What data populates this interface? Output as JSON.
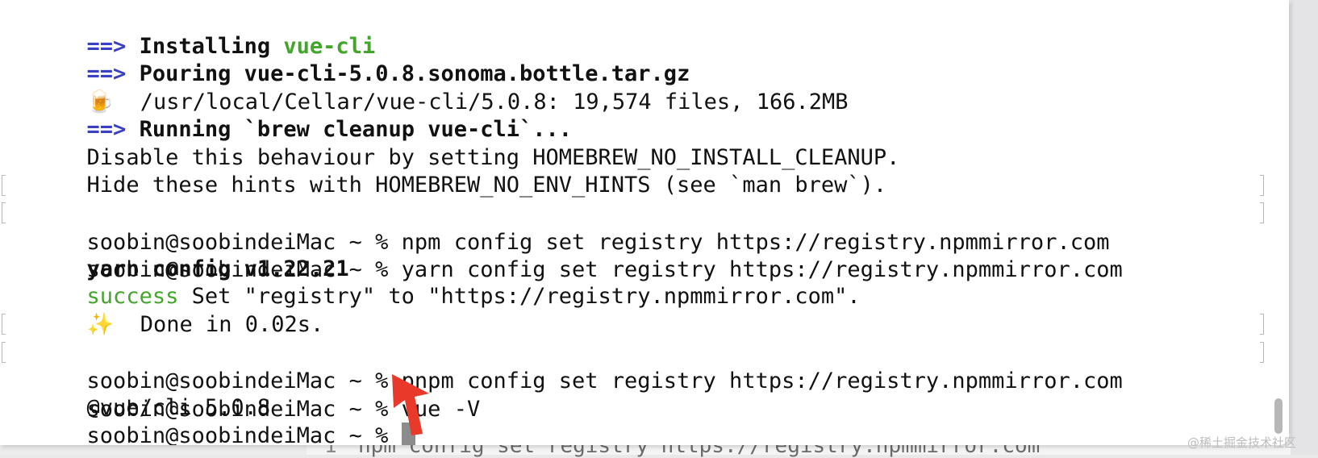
{
  "terminal": {
    "lines": [
      {
        "prefix": "==>",
        "text": "Installing ",
        "highlight": "vue-cli"
      },
      {
        "prefix": "==>",
        "text": "Pouring vue-cli-5.0.8.sonoma.bottle.tar.gz"
      },
      {
        "icon": "🍺",
        "text": "/usr/local/Cellar/vue-cli/5.0.8: 19,574 files, 166.2MB"
      },
      {
        "prefix": "==>",
        "text": "Running `brew cleanup vue-cli`..."
      },
      {
        "text": "Disable this behaviour by setting HOMEBREW_NO_INSTALL_CLEANUP."
      },
      {
        "text": "Hide these hints with HOMEBREW_NO_ENV_HINTS (see `man brew`)."
      },
      {
        "text": "soobin@soobindeiMac ~ % npm config set registry https://registry.npmmirror.com"
      },
      {
        "text": "soobin@soobindeiMac ~ % yarn config set registry https://registry.npmmirror.com"
      },
      {
        "text": "yarn config v1.22.21"
      },
      {
        "status": "success",
        "text": " Set \"registry\" to \"https://registry.npmmirror.com\"."
      },
      {
        "icon": "✨",
        "text": "Done in 0.02s."
      },
      {
        "text": "soobin@soobindeiMac ~ % pnpm config set registry https://registry.npmmirror.com"
      },
      {
        "text": "soobin@soobindeiMac ~ % vue -V"
      },
      {
        "text": "@vue/cli 5.0.8"
      },
      {
        "text": "soobin@soobindeiMac ~ % "
      }
    ]
  },
  "editor_behind": {
    "line_number": "1",
    "code": "npm config set registry https://registry.npmmirror.com"
  },
  "watermark": "@稀土掘金技术社区",
  "colors": {
    "arrow_prompt": "#3b3fc4",
    "success": "#44a52c",
    "annotation_arrow": "#e8392b"
  }
}
